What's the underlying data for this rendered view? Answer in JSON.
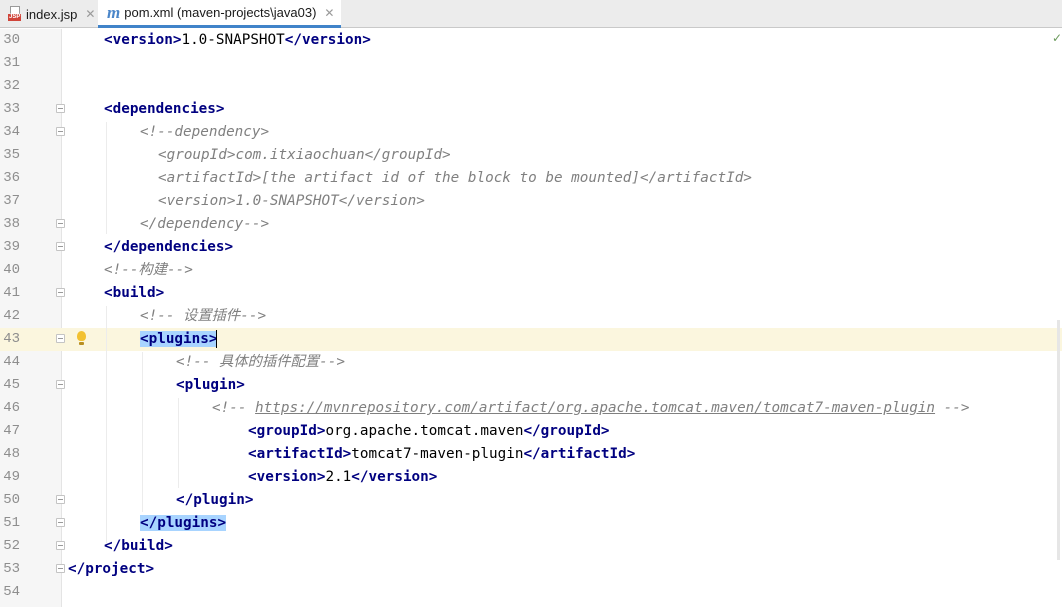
{
  "tabs": [
    {
      "label": "index.jsp",
      "icon": "jsp-file-icon"
    },
    {
      "label": "pom.xml (maven-projects\\java03)",
      "icon": "maven-file-icon"
    }
  ],
  "editor": {
    "current_line": 43,
    "lines": [
      {
        "n": "30",
        "t": "<version>1.0-SNAPSHOT</version>"
      },
      {
        "n": "31",
        "t": ""
      },
      {
        "n": "32",
        "t": ""
      },
      {
        "n": "33",
        "t": "<dependencies>"
      },
      {
        "n": "34",
        "t": "<!--dependency>"
      },
      {
        "n": "35",
        "t": "<groupId>com.itxiaochuan</groupId>"
      },
      {
        "n": "36",
        "t": "<artifactId>[the artifact id of the block to be mounted]</artifactId>"
      },
      {
        "n": "37",
        "t": "<version>1.0-SNAPSHOT</version>"
      },
      {
        "n": "38",
        "t": "</dependency-->"
      },
      {
        "n": "39",
        "t": "</dependencies>"
      },
      {
        "n": "40",
        "t": "<!--构建-->"
      },
      {
        "n": "41",
        "t": "<build>"
      },
      {
        "n": "42",
        "t": "<!-- 设置插件-->"
      },
      {
        "n": "43",
        "t": "<plugins>"
      },
      {
        "n": "44",
        "t": "<!-- 具体的插件配置-->"
      },
      {
        "n": "45",
        "t": "<plugin>"
      },
      {
        "n": "46",
        "t": "<!-- https://mvnrepository.com/artifact/org.apache.tomcat.maven/tomcat7-maven-plugin -->"
      },
      {
        "n": "47",
        "t": "<groupId>org.apache.tomcat.maven</groupId>"
      },
      {
        "n": "48",
        "t": "<artifactId>tomcat7-maven-plugin</artifactId>"
      },
      {
        "n": "49",
        "t": "<version>2.1</version>"
      },
      {
        "n": "50",
        "t": "</plugin>"
      },
      {
        "n": "51",
        "t": "</plugins>"
      },
      {
        "n": "52",
        "t": "</build>"
      },
      {
        "n": "53",
        "t": "</project>"
      },
      {
        "n": "54",
        "t": ""
      }
    ]
  },
  "tokens": {
    "l30": [
      "<version>",
      "1.0-SNAPSHOT",
      "</version>"
    ],
    "l33": [
      "<dependencies>"
    ],
    "l34": [
      "<!--dependency>"
    ],
    "l35": [
      "<groupId>com.itxiaochuan</groupId>"
    ],
    "l36": [
      "<artifactId>[the artifact id of the block to be mounted]</artifactId>"
    ],
    "l37": [
      "<version>1.0-SNAPSHOT</version>"
    ],
    "l38": [
      "</dependency-->"
    ],
    "l39": [
      "</dependencies>"
    ],
    "l40": [
      "<!--构建-->"
    ],
    "l41": [
      "<build>"
    ],
    "l42": [
      "<!-- 设置插件-->"
    ],
    "l43": [
      "<plugins>"
    ],
    "l44": [
      "<!-- 具体的插件配置-->"
    ],
    "l45": [
      "<plugin>"
    ],
    "l46": [
      "<!-- ",
      "https://mvnrepository.com/artifact/org.apache.tomcat.maven/tomcat7-maven-plugin",
      " -->"
    ],
    "l47": [
      "<groupId>",
      "org.apache.tomcat.maven",
      "</groupId>"
    ],
    "l48": [
      "<artifactId>",
      "tomcat7-maven-plugin",
      "</artifactId>"
    ],
    "l49": [
      "<version>",
      "2.1",
      "</version>"
    ],
    "l50": [
      "</plugin>"
    ],
    "l51": [
      "</plugins>"
    ],
    "l52": [
      "</build>"
    ],
    "l53": [
      "</project>"
    ]
  },
  "colors": {
    "tag": "#000080",
    "comment": "#808080",
    "selection": "#a8d4ff",
    "current_line": "#fbf6de",
    "tab_accent": "#4083c9"
  }
}
